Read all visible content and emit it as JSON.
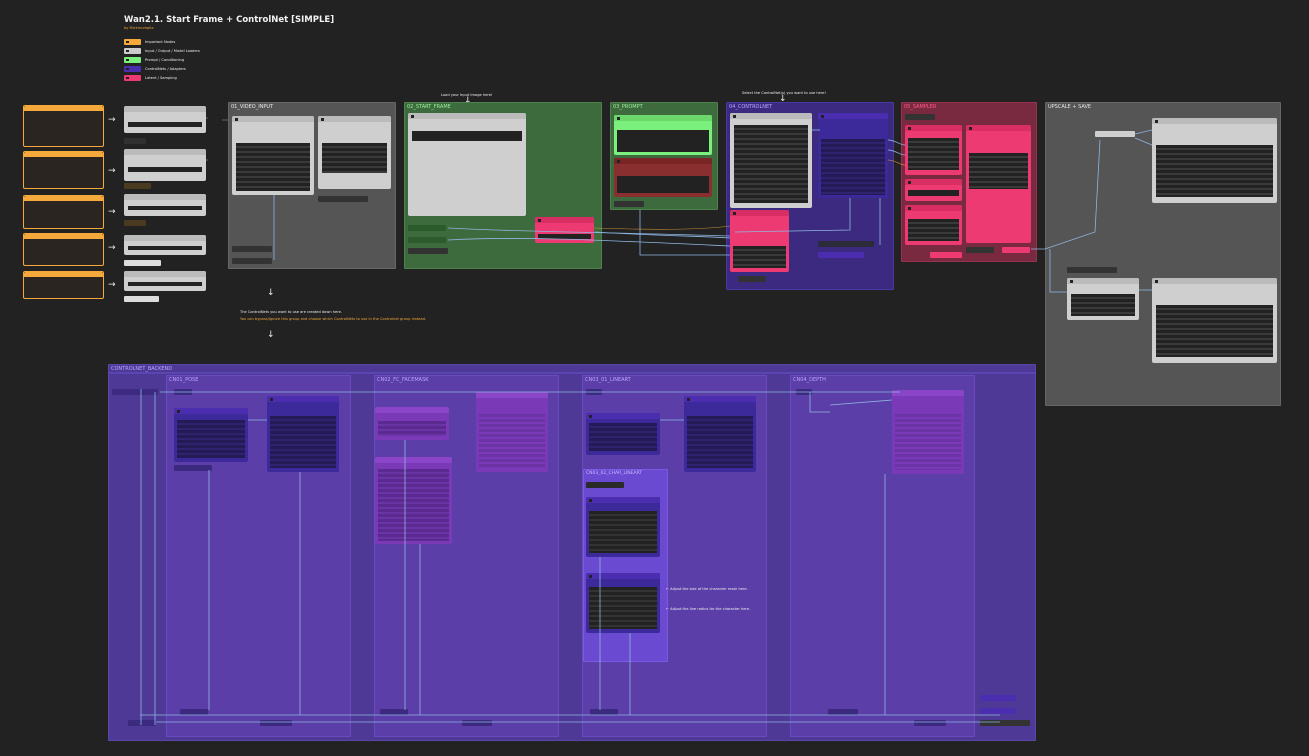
{
  "header": {
    "title": "Wan2.1. Start Frame + ControlNet [SIMPLE]",
    "author": "by Mickmumpitz"
  },
  "legend": [
    {
      "label": "Important Nodes",
      "color": "#f6a93b"
    },
    {
      "label": "Input / Output / Model Loaders",
      "color": "#cccccc"
    },
    {
      "label": "Prompt / Conditioning",
      "color": "#7cf07c"
    },
    {
      "label": "ControlNets / Adapters",
      "color": "#4b2db0"
    },
    {
      "label": "Latent / Sampling",
      "color": "#ee3a73"
    }
  ],
  "groups": {
    "video_input": "01_VIDEO_INPUT",
    "start_frame": "02_START_FRAME",
    "prompt": "03_PROMPT",
    "controlnet": "04_CONTROLNET",
    "sampler": "05_SAMPLER",
    "upscale": "UPSCALE + SAVE",
    "backend": "CONTROLNET_BACKEND",
    "pose": "CN01_POSE",
    "face": "CN02_FC_FACEMASK",
    "lineart": "CN03_01_LINEART",
    "lineart_sub": "CN03_02_CHAR_LINEART",
    "depth": "CN04_DEPTH"
  },
  "notes": {
    "load_image": "Load your Input Image here!",
    "select_controlnet": "Select the ControlNet(s) you want to use here!",
    "controlnets_created": "The ControlNets you want to use are created down here.",
    "controlnets_bypass": "You can bypass/ignore this group and choose which ControlNets to use in the Controlnet group instead.",
    "mask_size": "Adjust the size of the character mask here.",
    "line_radius": "Adjust the line radius for the character here."
  },
  "colors": {
    "important": "#f6a93b",
    "loader": "#cccccc",
    "prompt": "#7cf07c",
    "controlnet": "#4b2db0",
    "latent": "#ee3a73",
    "wire": "#8fb6e0"
  }
}
